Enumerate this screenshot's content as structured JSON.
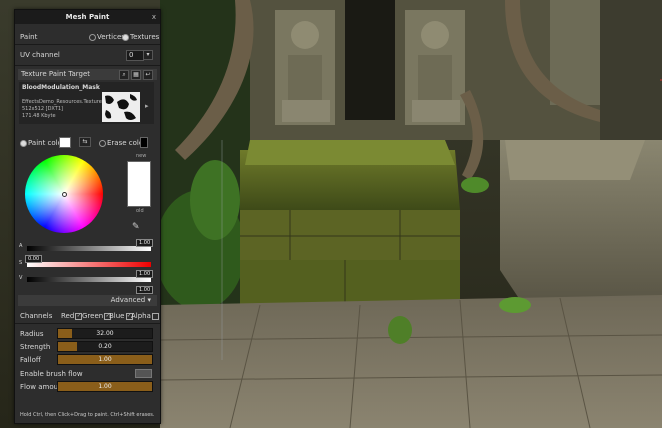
{
  "window": {
    "title": "Mesh Paint",
    "close_label": "x"
  },
  "paint": {
    "label": "Paint",
    "vertices_label": "Vertices",
    "textures_label": "Textures",
    "selected": "Textures"
  },
  "uv_channel": {
    "label": "UV channel",
    "value": "0"
  },
  "texture_target": {
    "label": "Texture Paint Target",
    "name": "BloodModulation_Mask",
    "path_line": "EffectsDemo_Resources.Textures",
    "format_line": "512x512 [DXT1]",
    "size_line": "171.48 Kbyte"
  },
  "colors": {
    "paint_color_label": "Paint color",
    "erase_color_label": "Erase color",
    "paint_color": "#ffffff",
    "erase_color": "#000000",
    "new_label": "new",
    "old_label": "old"
  },
  "sliders": {
    "a_label": "A",
    "s_label": "S",
    "v_label": "V",
    "a_value": "1.00",
    "s_value": "0.00",
    "v_value": "1.00",
    "extra_value": "1.00",
    "a_level": 1.0,
    "s_level": 0.0,
    "v_level": 1.0
  },
  "advanced_label": "Advanced",
  "channels": {
    "label": "Channels",
    "red": "Red",
    "green": "Green",
    "blue": "Blue",
    "alpha": "Alpha",
    "red_checked": true,
    "green_checked": true,
    "blue_checked": true,
    "alpha_checked": false
  },
  "brush": {
    "radius_label": "Radius",
    "radius_value": "32.00",
    "radius_level": 0.15,
    "strength_label": "Strength",
    "strength_value": "0.20",
    "strength_level": 0.2,
    "falloff_label": "Falloff",
    "falloff_value": "1.00",
    "falloff_level": 1.0,
    "flow_label": "Enable brush flow",
    "flow_amount_label": "Flow amount",
    "flow_amount_value": "1.00",
    "flow_amount_level": 1.0
  },
  "help_text": "Hold Ctrl, then Click+Drag to paint. Ctrl+Shift erases."
}
